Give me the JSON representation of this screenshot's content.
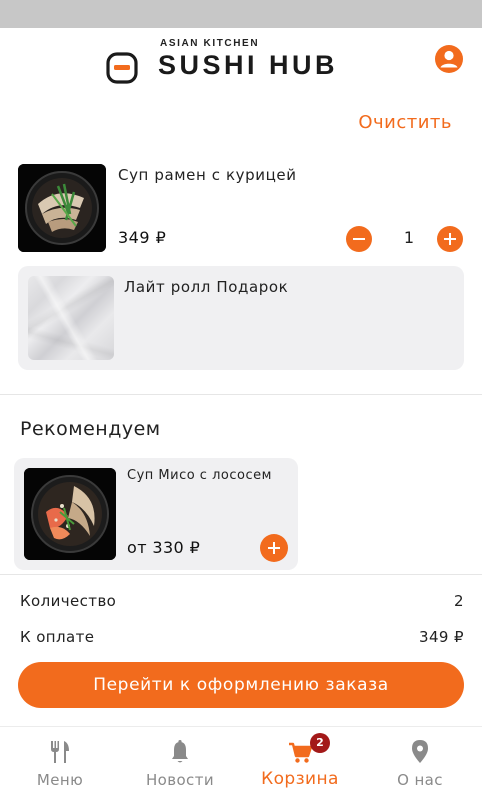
{
  "header": {
    "logo_small": "ASIAN KITCHEN",
    "logo_big": "SUSHI HUB"
  },
  "cart": {
    "clear_label": "Очистить",
    "items": [
      {
        "name": "Суп рамен с курицей",
        "price": "349 ₽",
        "quantity": "1"
      },
      {
        "name": "Лайт ролл Подарок"
      }
    ]
  },
  "recommend": {
    "title": "Рекомендуем",
    "items": [
      {
        "name": "Суп Мисо с лососем",
        "price": "от 330 ₽"
      }
    ]
  },
  "summary": {
    "quantity_label": "Количество",
    "quantity_value": "2",
    "pay_label": "К оплате",
    "pay_value": "349 ₽",
    "checkout_label": "Перейти к оформлению заказа"
  },
  "tabbar": {
    "tabs": [
      {
        "label": "Меню",
        "icon": "fork-knife-icon"
      },
      {
        "label": "Новости",
        "icon": "bell-icon"
      },
      {
        "label": "Корзина",
        "icon": "cart-icon",
        "badge": "2",
        "active": true
      },
      {
        "label": "О нас",
        "icon": "location-pin-icon"
      }
    ]
  },
  "colors": {
    "accent": "#f26b1d",
    "badge": "#a31919",
    "card_bg": "#f0f0f2",
    "inactive_tab": "#8a8a8a"
  }
}
